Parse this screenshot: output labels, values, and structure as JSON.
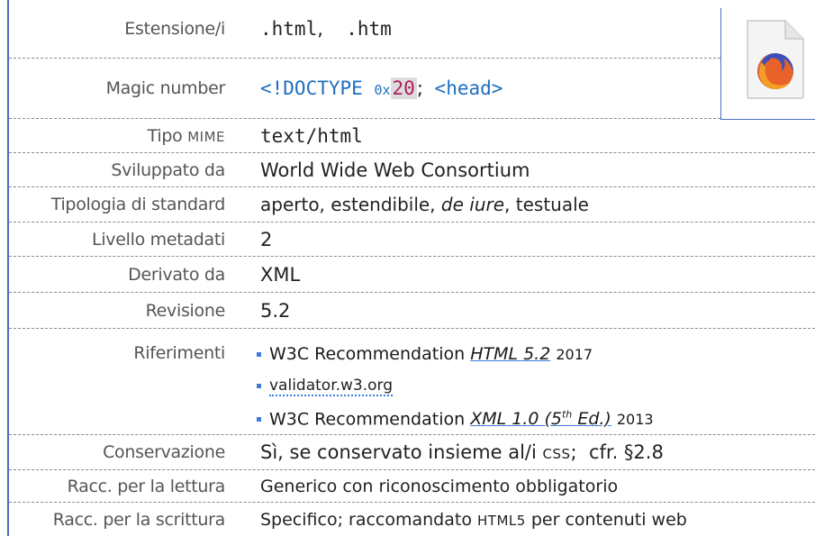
{
  "rows": {
    "estensione": {
      "label": "Estensione/i",
      "ext1": ".html",
      "sep": ",",
      "ext2": ".htm"
    },
    "magic": {
      "label": "Magic number",
      "doctype": "<!DOCTYPE",
      "hex_prefix": "0x",
      "hex_value": "20",
      "sep": ";",
      "head": "<head>"
    },
    "mime": {
      "label_main": "Tipo",
      "label_sc": "MIME",
      "value": "text/html"
    },
    "sviluppato": {
      "label": "Sviluppato da",
      "value": "World Wide Web Consortium"
    },
    "tipologia": {
      "label": "Tipologia di standard",
      "value_a": "aperto, estendibile, ",
      "value_italic": "de iure",
      "value_b": ", testuale"
    },
    "livello": {
      "label": "Livello metadati",
      "value": "2"
    },
    "derivato": {
      "label": "Derivato da",
      "value": "XML"
    },
    "revisione": {
      "label": "Revisione",
      "value": "5.2"
    },
    "riferimenti": {
      "label": "Riferimenti",
      "items": [
        {
          "prefix": "W3C Recommendation ",
          "title": "HTML 5.2",
          "year": "2017"
        },
        {
          "link": "validator.w3.org"
        },
        {
          "prefix": "W3C Recommendation ",
          "title_a": "XML 1.0 (5",
          "title_sup": "th",
          "title_b": " Ed.)",
          "year": "2013"
        }
      ]
    },
    "conservazione": {
      "label": "Conservazione",
      "value_a": "Sì, se conservato insieme al/i ",
      "value_sc": "CSS",
      "value_b": ";  cfr. §2.8"
    },
    "lettura": {
      "label": "Racc. per la lettura",
      "value": "Generico con riconoscimento obbligatorio"
    },
    "scrittura": {
      "label": "Racc. per la scrittura",
      "value_a": "Specifico; raccomandato ",
      "value_sc": "HTML5",
      "value_b": " per contenuti web"
    }
  },
  "icon": {
    "name": "firefox-file-icon",
    "accent": "#e8622a",
    "globe": "#3b4fb8"
  },
  "colors": {
    "accent": "#4a6fc0",
    "code_blue": "#1f6fbf",
    "code_red": "#b0205a",
    "label_gray": "#555555"
  }
}
